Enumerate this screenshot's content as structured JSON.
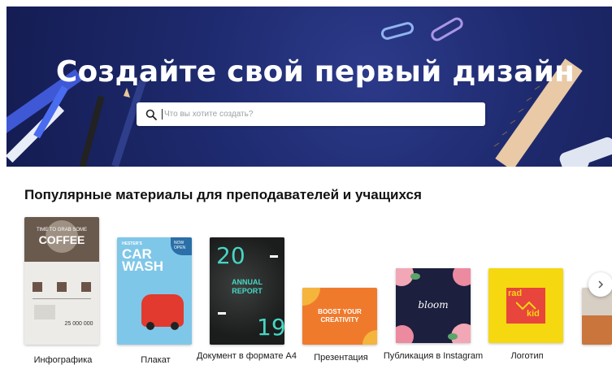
{
  "hero": {
    "title": "Создайте свой первый дизайн",
    "search_placeholder": "Что вы хотите создать?"
  },
  "section": {
    "title": "Популярные материалы для преподавателей и учащихся"
  },
  "cards": [
    {
      "label": "Инфографика",
      "thumb_text": [
        "TIME TO GRAB SOME",
        "COFFEE",
        "25 000 000"
      ]
    },
    {
      "label": "Плакат",
      "thumb_text": [
        "HESTER'S",
        "CAR",
        "WASH",
        "NOW",
        "OPEN"
      ]
    },
    {
      "label": "Документ в формате А4",
      "thumb_text": [
        "20",
        "ANNUAL",
        "REPORT",
        "19"
      ]
    },
    {
      "label": "Презентация",
      "thumb_text": [
        "BOOST YOUR",
        "CREATIVITY"
      ]
    },
    {
      "label": "Публикация в Instagram",
      "thumb_text": [
        "bloom"
      ]
    },
    {
      "label": "Логотип",
      "thumb_text": [
        "rad",
        "kid"
      ]
    }
  ],
  "colors": {
    "hero_bg": "#1e2a6e",
    "logo_yellow": "#f5d80f",
    "logo_red": "#e8453c"
  },
  "icons": {
    "search": "search-icon",
    "next": "chevron-right-icon"
  }
}
